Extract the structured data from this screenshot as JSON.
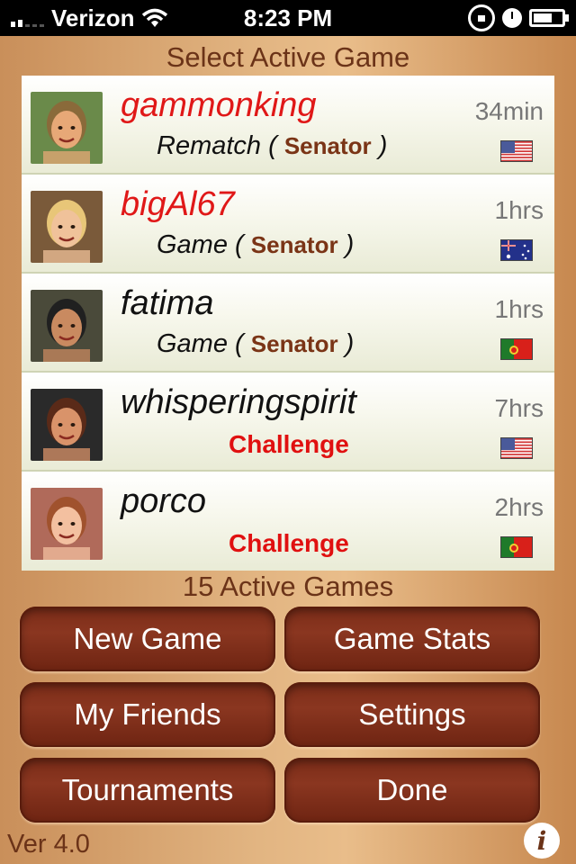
{
  "status_bar": {
    "carrier": "Verizon",
    "time": "8:23 PM"
  },
  "header": {
    "title": "Select Active Game"
  },
  "games": [
    {
      "name": "gammonking",
      "name_color": "red",
      "type": "Rematch",
      "opponent": "Senator",
      "challenge": "",
      "time": "34min",
      "flag": "usa",
      "avatar_bg": "#6a8a4a",
      "avatar_skin": "#e7a877",
      "avatar_hair": "#8a6a3a"
    },
    {
      "name": "bigAl67",
      "name_color": "red",
      "type": "Game",
      "opponent": "Senator",
      "challenge": "",
      "time": "1hrs",
      "flag": "australia",
      "avatar_bg": "#7a5a3a",
      "avatar_skin": "#f0c29a",
      "avatar_hair": "#e8c678"
    },
    {
      "name": "fatima",
      "name_color": "black",
      "type": "Game",
      "opponent": "Senator",
      "challenge": "",
      "time": "1hrs",
      "flag": "portugal",
      "avatar_bg": "#4a4a3a",
      "avatar_skin": "#c98a60",
      "avatar_hair": "#202020"
    },
    {
      "name": "whisperingspirit",
      "name_color": "black",
      "type": "",
      "opponent": "",
      "challenge": "Challenge",
      "time": "7hrs",
      "flag": "usa",
      "avatar_bg": "#2a2a2a",
      "avatar_skin": "#d9936a",
      "avatar_hair": "#5a2a18"
    },
    {
      "name": "porco",
      "name_color": "black",
      "type": "",
      "opponent": "",
      "challenge": "Challenge",
      "time": "2hrs",
      "flag": "portugal",
      "avatar_bg": "#b06a5a",
      "avatar_skin": "#f3c0a0",
      "avatar_hair": "#a0522d"
    }
  ],
  "footer": {
    "active_count": "15 Active Games",
    "version": "Ver 4.0"
  },
  "buttons": {
    "new_game": "New Game",
    "game_stats": "Game Stats",
    "my_friends": "My Friends",
    "settings": "Settings",
    "tournaments": "Tournaments",
    "done": "Done"
  },
  "info_icon": "i",
  "colors": {
    "accent_brown": "#6b3318",
    "button_brown": "#7b2c18",
    "name_red": "#e01818"
  }
}
